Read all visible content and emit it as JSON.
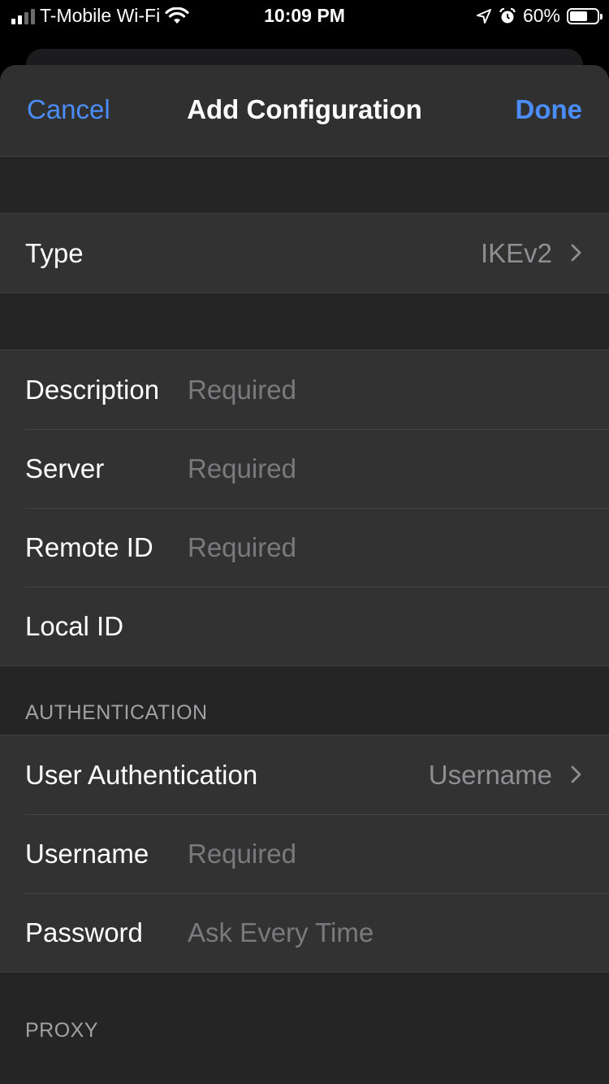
{
  "status_bar": {
    "carrier": "T-Mobile Wi-Fi",
    "time": "10:09 PM",
    "battery": "60%"
  },
  "nav": {
    "cancel_label": "Cancel",
    "title": "Add Configuration",
    "done_label": "Done"
  },
  "type_row": {
    "label": "Type",
    "value": "IKEv2"
  },
  "fields": [
    {
      "label": "Description",
      "placeholder": "Required"
    },
    {
      "label": "Server",
      "placeholder": "Required"
    },
    {
      "label": "Remote ID",
      "placeholder": "Required"
    },
    {
      "label": "Local ID",
      "placeholder": ""
    }
  ],
  "authentication": {
    "header": "AUTHENTICATION",
    "user_auth_label": "User Authentication",
    "user_auth_value": "Username",
    "username_label": "Username",
    "username_placeholder": "Required",
    "password_label": "Password",
    "password_placeholder": "Ask Every Time"
  },
  "proxy": {
    "header": "PROXY"
  },
  "colors": {
    "accent": "#4a8df8",
    "sheet_bg": "#252525",
    "cell_bg": "#323232"
  }
}
